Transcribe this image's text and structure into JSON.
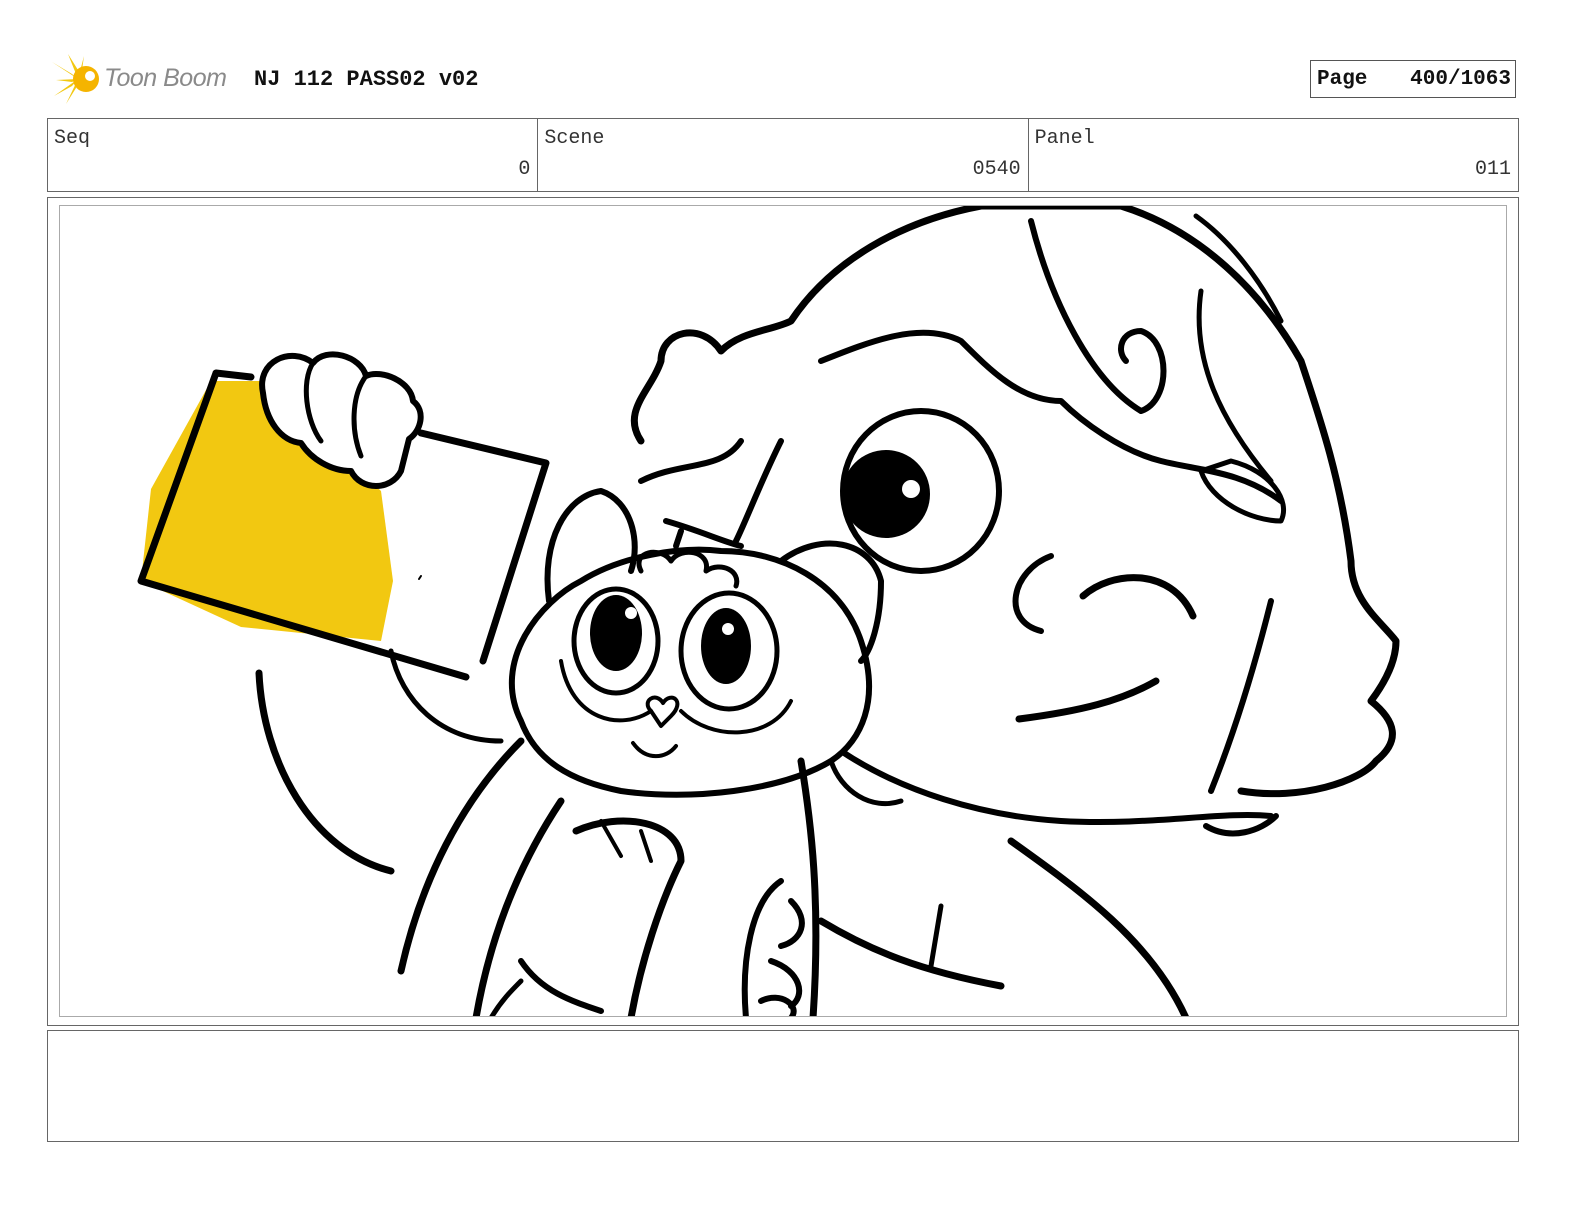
{
  "header": {
    "logo_text": "Toon Boom",
    "title": "NJ 112 PASS02 v02",
    "page_label": "Page",
    "page_value": "400/1063"
  },
  "info": {
    "seq_label": "Seq",
    "seq_value": "0",
    "scene_label": "Scene",
    "scene_value": "0540",
    "panel_label": "Panel",
    "panel_value": "011"
  },
  "notes": {
    "text": ""
  },
  "colors": {
    "accent_yellow": "#f2c811",
    "line": "#000000",
    "border": "#666666"
  },
  "icons": {
    "logo": "toon-boom-sun-icon"
  }
}
